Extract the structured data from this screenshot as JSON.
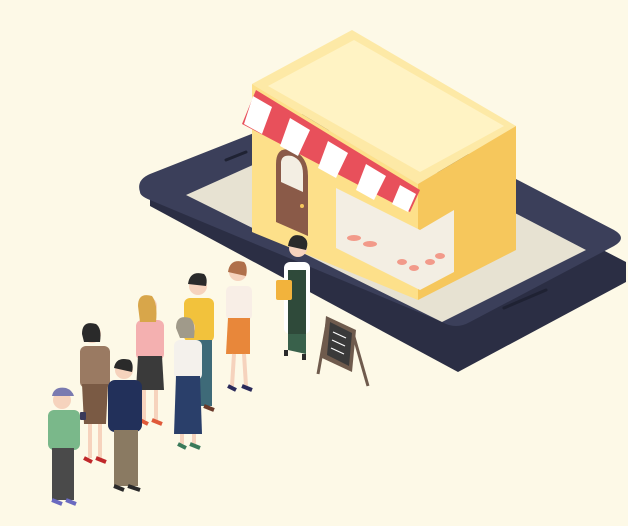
{
  "colors": {
    "background": "#fdf9e7",
    "phone_body": "#3b3f5a",
    "phone_edge": "#2b2e44",
    "phone_screen": "#e7e2d2",
    "shop_wall_front": "#fde08a",
    "shop_wall_side": "#f6c75c",
    "shop_roof": "#fde9a6",
    "awning_red": "#e8505b",
    "awning_white": "#ffffff",
    "door": "#8a5a48",
    "window_glass": "#f3eee3",
    "display_items": "#f29a8a",
    "board": "#6f5b4d",
    "board_face": "#3a3a3a",
    "skin": "#f6d3bd"
  },
  "icons": [
    "smartphone",
    "shop",
    "awning",
    "door",
    "display-window",
    "shop-staff",
    "shopping-bag",
    "menu-board",
    "customer"
  ]
}
